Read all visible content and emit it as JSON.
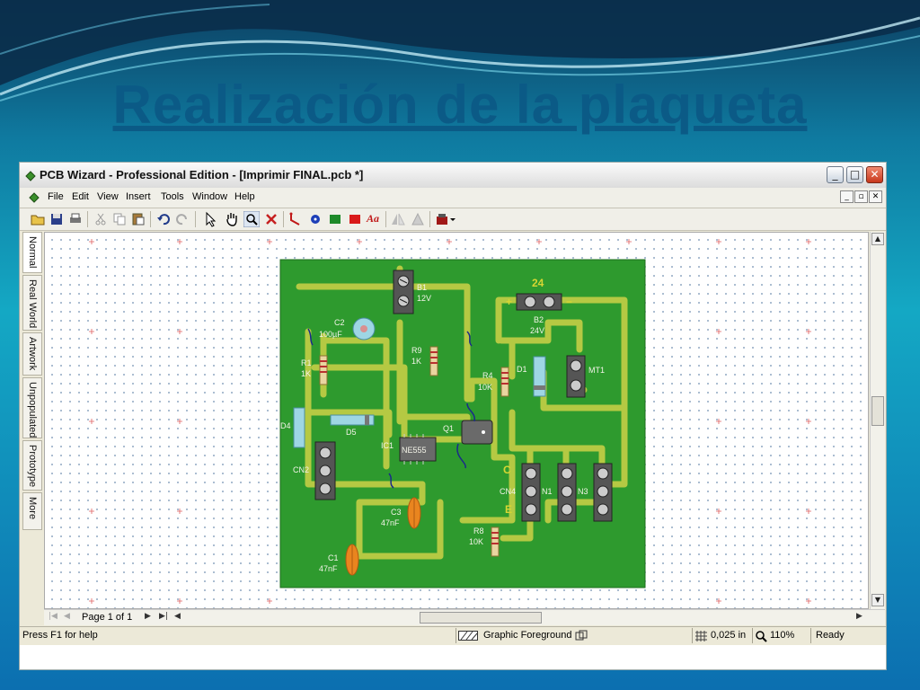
{
  "slide": {
    "title": "Realización de la plaqueta"
  },
  "window": {
    "title": "PCB Wizard - Professional Edition - [Imprimir FINAL.pcb *]",
    "caption_buttons": [
      "_",
      "□",
      "✕"
    ]
  },
  "menu": {
    "items": [
      "File",
      "Edit",
      "View",
      "Insert",
      "Tools",
      "Window",
      "Help"
    ],
    "mdi_buttons": [
      "_",
      "▫",
      "✕"
    ]
  },
  "toolbar": {
    "icons": [
      "open-folder-icon",
      "save-icon",
      "print-icon",
      "cut-icon",
      "copy-icon",
      "paste-icon",
      "undo-icon",
      "redo-icon",
      "select-arrow-icon",
      "hand-pan-icon",
      "zoom-icon",
      "delete-icon",
      "track-icon",
      "pad-icon",
      "rectangle-green-icon",
      "rectangle-red-icon",
      "text-icon",
      "mirror-icon",
      "flip-icon",
      "component-box-icon"
    ],
    "text_tool_label": "Aa"
  },
  "side_tabs": [
    "Normal",
    "Real World",
    "Artwork",
    "Unpopulated",
    "Prototype",
    "More"
  ],
  "pcb": {
    "labels": [
      "B1",
      "12V",
      "C2",
      "100µF",
      "R9",
      "1K",
      "R1",
      "1K",
      "R4",
      "10K",
      "D1",
      "MT1",
      "B2",
      "24V",
      "D4",
      "D5",
      "IC1",
      "Q1",
      "CN2",
      "CN4",
      "N1",
      "N3",
      "C3",
      "47nF",
      "C1",
      "47nF",
      "R8",
      "10K",
      "NE555"
    ],
    "marker_labels": [
      "24",
      "C",
      "E",
      "+",
      "−"
    ],
    "colors": {
      "board": "#2e9a2e",
      "track": "#b5c943",
      "connector": "#3d3d3d",
      "capacitor_orange": "#e9851f",
      "electrolytic": "#9ed6e4"
    }
  },
  "navigation": {
    "page": "Page 1 of 1"
  },
  "status": {
    "help": "Press F1 for help",
    "layer": "Graphic Foreground",
    "grid": "0,025 in",
    "zoom": "110%",
    "state": "Ready"
  }
}
